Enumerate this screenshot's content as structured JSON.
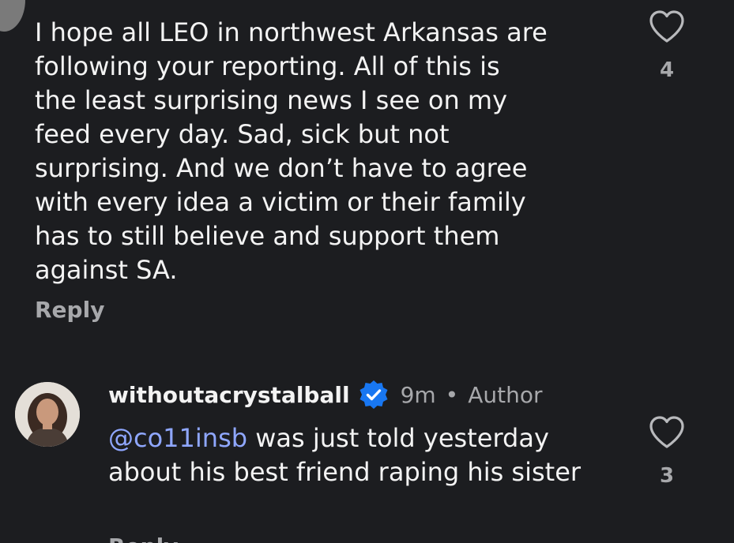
{
  "comment1": {
    "text": "I hope all LEO in northwest Arkansas are\nfollowing your reporting. All of this is\nthe least surprising news I see on my\nfeed every day. Sad, sick but not\nsurprising. And we don’t have to agree\nwith every idea a victim or their family\nhas to still believe and support them\nagainst SA.",
    "reply_label": "Reply",
    "like_count": "4",
    "like_icon": "heart-outline-icon"
  },
  "comment2": {
    "username": "withoutacrystalball",
    "verified_icon": "verified-badge-icon",
    "time": "9m",
    "separator": "•",
    "role": "Author",
    "mention": "@co11insb",
    "text": " was just told yesterday about his best friend raping his sister",
    "reply_label": "Reply",
    "like_count": "3",
    "like_icon": "heart-outline-icon"
  },
  "colors": {
    "background": "#1c1d20",
    "text": "#f3f3f3",
    "secondary_text": "#a7a8ab",
    "mention": "#8fa7ff",
    "verified": "#1877f2"
  }
}
